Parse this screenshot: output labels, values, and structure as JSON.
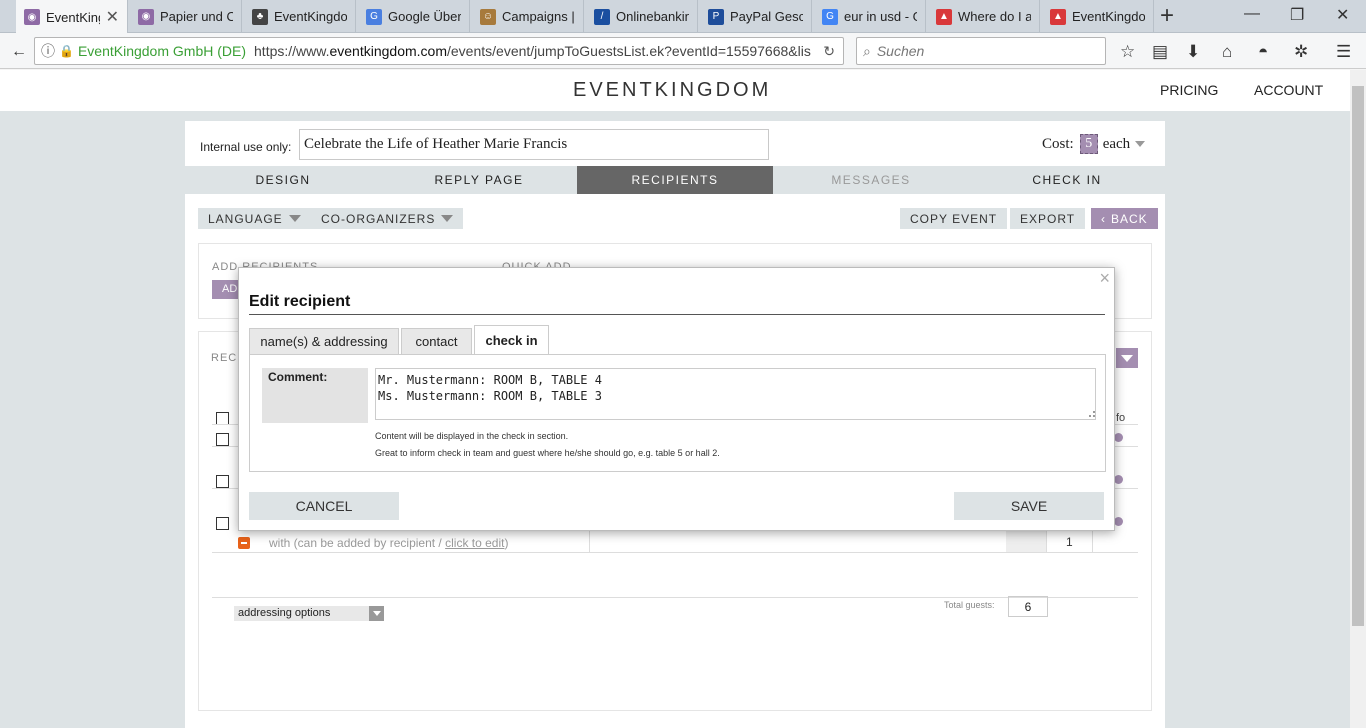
{
  "browser": {
    "tabs": [
      {
        "title": "EventKing",
        "active": true,
        "color": "#8e6aa5"
      },
      {
        "title": "Papier und Or",
        "color": "#8e6aa5"
      },
      {
        "title": "EventKingdom",
        "color": "#444"
      },
      {
        "title": "Google Übers",
        "color": "#4a7fe0"
      },
      {
        "title": "Campaigns | ",
        "color": "#a77a3c"
      },
      {
        "title": "Onlinebankin",
        "color": "#1b4fa0"
      },
      {
        "title": "PayPal Gesch",
        "color": "#1e4d9a"
      },
      {
        "title": "eur in usd - G",
        "color": "#4285f4"
      },
      {
        "title": "Where do I ad",
        "color": "#d9383a"
      },
      {
        "title": "EventKingdom",
        "color": "#d9383a"
      }
    ],
    "url_org": "EventKingdom GmbH (DE)",
    "url_prefix": "https://www.",
    "url_domain": "eventkingdom.com",
    "url_rest": "/events/event/jumpToGuestsList.ek?eventId=15597668&lis",
    "search_placeholder": "Suchen"
  },
  "site": {
    "logo": "EVENTKINGDOM",
    "nav": [
      "PRICING",
      "ACCOUNT"
    ]
  },
  "event": {
    "internal_label": "Internal use only:",
    "internal_value": "Celebrate the Life of Heather Marie Francis",
    "cost_label": "Cost:",
    "cost_value": "5",
    "cost_unit": "each"
  },
  "tabs": [
    "DESIGN",
    "REPLY PAGE",
    "RECIPIENTS",
    "MESSAGES",
    "CHECK IN"
  ],
  "toolbar": {
    "language": "LANGUAGE",
    "coorganizers": "CO-ORGANIZERS",
    "copy_event": "COPY EVENT",
    "export": "EXPORT",
    "back": "BACK"
  },
  "add_box": {
    "add_recipients": "ADD RECIPIENTS",
    "quick_add": "QUICK ADD",
    "add_btn": "AD"
  },
  "recipients_box": {
    "label": "REC",
    "info_col": "fo",
    "with_text": "with (can be added by recipient / ",
    "with_link": "click to edit",
    "with_close": ")",
    "count": "1",
    "addressing_options": "addressing options",
    "total_label": "Total guests:",
    "total_value": "6"
  },
  "modal": {
    "title": "Edit recipient",
    "tabs": [
      "name(s) & addressing",
      "contact",
      "check in"
    ],
    "comment_label": "Comment:",
    "comment_value": "Mr. Mustermann: ROOM B, TABLE 4\nMs. Mustermann: ROOM B, TABLE 3",
    "hint1": "Content will be displayed in the check in section.",
    "hint2": "Great to inform check in team and guest where he/she should go, e.g. table 5 or hall 2.",
    "cancel": "CANCEL",
    "save": "SAVE"
  }
}
